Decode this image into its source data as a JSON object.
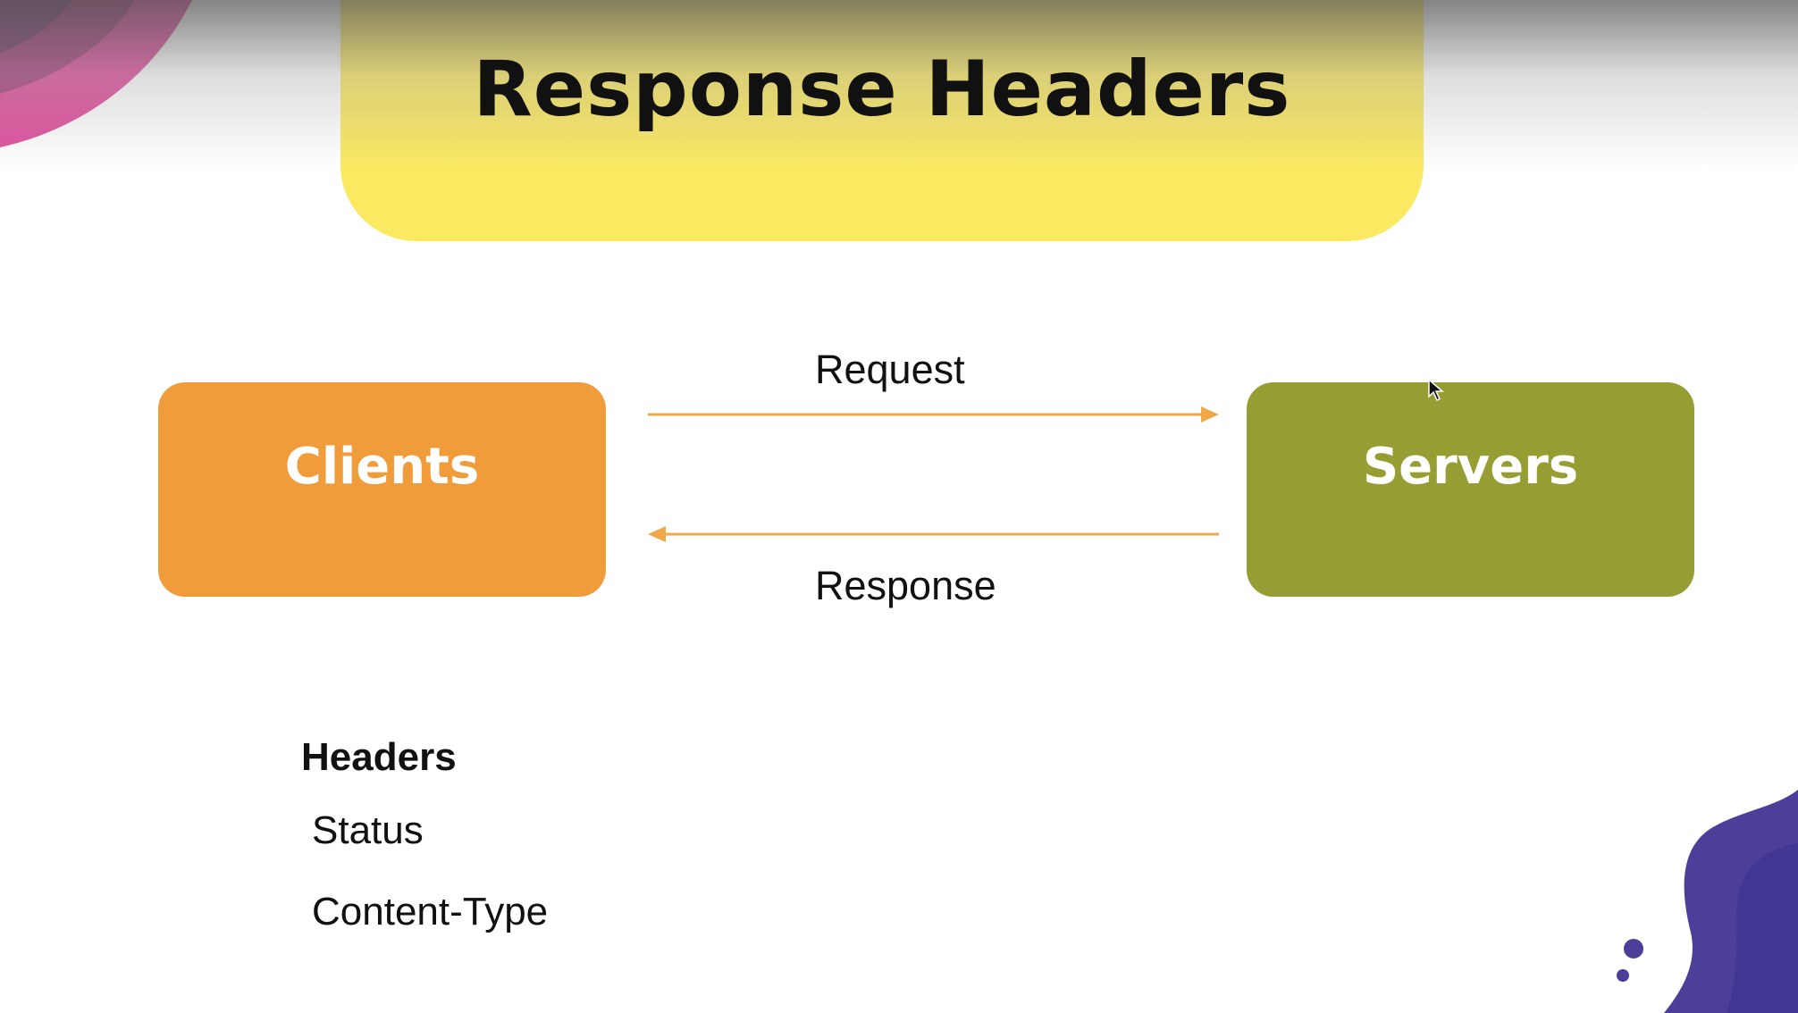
{
  "slide": {
    "title": "Response Headers",
    "colors": {
      "banner": "#fbe962",
      "clients_box": "#f09c3b",
      "servers_box": "#969d33",
      "arrow": "#f0a94a",
      "deco_pink": "#e0509e",
      "deco_purple": "#4b3f9a"
    }
  },
  "diagram": {
    "clients_label": "Clients",
    "servers_label": "Servers",
    "request_label": "Request",
    "response_label": "Response"
  },
  "headers": {
    "heading": "Headers",
    "items": [
      "Status",
      "Content-Type"
    ]
  }
}
